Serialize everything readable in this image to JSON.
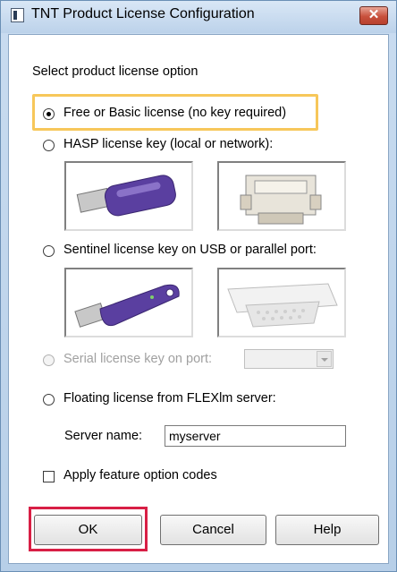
{
  "window": {
    "title": "TNT Product License Configuration",
    "close_symbol": "✕"
  },
  "dialog": {
    "section_label": "Select product license option",
    "options": [
      {
        "label": "Free or Basic license (no key required)",
        "checked": true,
        "enabled": true
      },
      {
        "label": "HASP license key (local or network):",
        "checked": false,
        "enabled": true
      },
      {
        "label": "Sentinel license key on USB or parallel port:",
        "checked": false,
        "enabled": true
      },
      {
        "label": "Serial license key on port:",
        "checked": false,
        "enabled": false
      },
      {
        "label": "Floating license from FLEXlm server:",
        "checked": false,
        "enabled": true
      }
    ],
    "serial_port": {
      "value": ""
    },
    "server_name": {
      "label": "Server name:",
      "value": "myserver"
    },
    "feature_codes": {
      "label": "Apply feature option codes",
      "checked": false
    },
    "buttons": {
      "ok": "OK",
      "cancel": "Cancel",
      "help": "Help"
    }
  },
  "icons": {
    "app": "app-icon",
    "hasp_usb": "hasp-usb-key-icon",
    "hasp_parallel": "hasp-parallel-key-icon",
    "sentinel_usb": "sentinel-usb-key-icon",
    "sentinel_parallel": "sentinel-parallel-key-icon"
  },
  "colors": {
    "selection_highlight": "#f7c75a",
    "ok_highlight": "#d81f45",
    "key_purple": "#5a3fa0"
  }
}
